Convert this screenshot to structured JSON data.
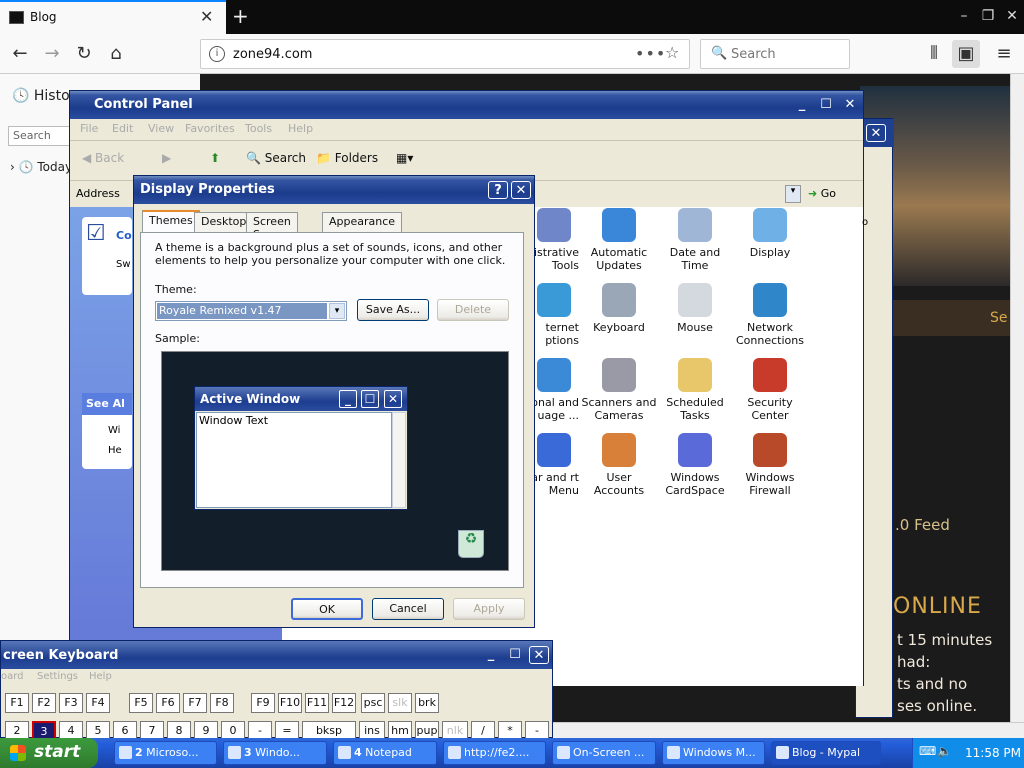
{
  "browser": {
    "tab_title": "Blog",
    "url": "zone94.com",
    "search_placeholder": "Search",
    "sidebar_title": "History",
    "sidebar_search_placeholder": "Search",
    "sidebar_today": "Today"
  },
  "page": {
    "band_text": "Se",
    "feed_text": ".0 Feed",
    "online_text": "ONLINE",
    "lines": [
      "t 15 minutes",
      "had:",
      "ts and no",
      "ses online."
    ]
  },
  "control_panel": {
    "title": "Control Panel",
    "menu": [
      "File",
      "Edit",
      "View",
      "Favorites",
      "Tools",
      "Help"
    ],
    "toolbar": {
      "back": "Back",
      "search": "Search",
      "folders": "Folders"
    },
    "address_label": "Address",
    "go_label": "Go",
    "left_pane": {
      "box1_title": "Co",
      "box1_item": "Sw",
      "box2_title": "See Al",
      "box2_item1": "Wi",
      "box2_item2": "He"
    },
    "icons": [
      {
        "name": "administrative-tools",
        "label": "nistrative Tools",
        "color": "#6f86c9"
      },
      {
        "name": "automatic-updates",
        "label": "Automatic Updates",
        "color": "#3a86d8"
      },
      {
        "name": "date-and-time",
        "label": "Date and Time",
        "color": "#9fb6d6"
      },
      {
        "name": "display",
        "label": "Display",
        "color": "#6fb0e6"
      },
      {
        "name": "internet-options",
        "label": "ternet ptions",
        "color": "#3a9ad8"
      },
      {
        "name": "keyboard",
        "label": "Keyboard",
        "color": "#9aa7b7"
      },
      {
        "name": "mouse",
        "label": "Mouse",
        "color": "#d4d8df"
      },
      {
        "name": "network-connections",
        "label": "Network Connections",
        "color": "#2f86c8"
      },
      {
        "name": "regional-language",
        "label": "onal and uage ...",
        "color": "#3a8ad8"
      },
      {
        "name": "scanners-cameras",
        "label": "Scanners and Cameras",
        "color": "#9a9aa6"
      },
      {
        "name": "scheduled-tasks",
        "label": "Scheduled Tasks",
        "color": "#e7c76a"
      },
      {
        "name": "security-center",
        "label": "Security Center",
        "color": "#c83a2a"
      },
      {
        "name": "taskbar-start-menu",
        "label": "bar and rt Menu",
        "color": "#3a6ad8"
      },
      {
        "name": "user-accounts",
        "label": "User Accounts",
        "color": "#d8803a"
      },
      {
        "name": "windows-cardspace",
        "label": "Windows CardSpace",
        "color": "#5a6ad8"
      },
      {
        "name": "windows-firewall",
        "label": "Windows Firewall",
        "color": "#b84a2a"
      }
    ],
    "partial_right": "o"
  },
  "display_props": {
    "title": "Display Properties",
    "tabs": [
      "Themes",
      "Desktop",
      "Screen Saver",
      "Appearance"
    ],
    "description": "A theme is a background plus a set of sounds, icons, and other elements to help you personalize your computer with one click.",
    "theme_label": "Theme:",
    "theme_value": "Royale Remixed v1.47",
    "save_as": "Save As...",
    "delete": "Delete",
    "sample_label": "Sample:",
    "active_window_title": "Active Window",
    "window_text": "Window Text",
    "ok": "OK",
    "cancel": "Cancel",
    "apply": "Apply"
  },
  "osk": {
    "title": "creen Keyboard",
    "menu": [
      "oard",
      "Settings",
      "Help"
    ],
    "row1": [
      "F1",
      "F2",
      "F3",
      "F4",
      "F5",
      "F6",
      "F7",
      "F8",
      "F9",
      "F10",
      "F11",
      "F12",
      "psc",
      "slk",
      "brk"
    ],
    "row2": [
      "2",
      "3",
      "4",
      "5",
      "6",
      "7",
      "8",
      "9",
      "0",
      "-",
      "=",
      "bksp",
      "ins",
      "hm",
      "pup",
      "nlk",
      "/",
      "*",
      "-"
    ]
  },
  "taskbar": {
    "start": "start",
    "tasks": [
      {
        "num": "2",
        "label": "Microso..."
      },
      {
        "num": "3",
        "label": "Windo..."
      },
      {
        "num": "4",
        "label": "Notepad"
      },
      {
        "num": "",
        "label": "http://fe2...."
      },
      {
        "num": "",
        "label": "On-Screen ..."
      },
      {
        "num": "",
        "label": "Windows M..."
      },
      {
        "num": "",
        "label": "Blog - Mypal"
      }
    ],
    "clock": "11:58 PM"
  }
}
